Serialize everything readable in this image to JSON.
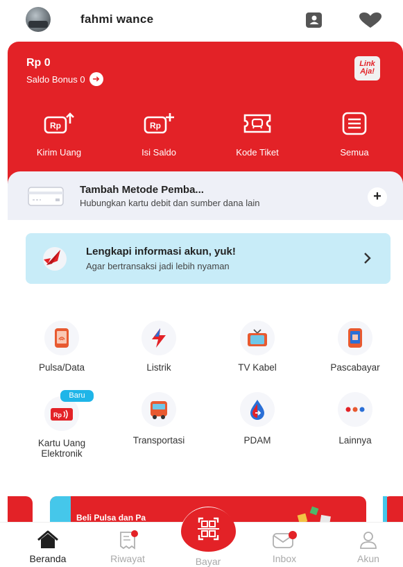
{
  "header": {
    "username": "fahmi wance",
    "icons": [
      "contacts-icon",
      "heart-icon"
    ]
  },
  "balance_card": {
    "balance": "Rp 0",
    "bonus_label": "Saldo Bonus 0",
    "logo_text_1": "Link",
    "logo_text_2": "Aja!",
    "quick_actions": [
      {
        "label": "Kirim Uang",
        "icon": "send-money-icon"
      },
      {
        "label": "Isi Saldo",
        "icon": "top-up-icon"
      },
      {
        "label": "Kode Tiket",
        "icon": "ticket-code-icon"
      },
      {
        "label": "Semua",
        "icon": "all-menu-icon"
      }
    ],
    "color": "#e32227"
  },
  "payment_method": {
    "title": "Tambah Metode Pemba...",
    "subtitle": "Hubungkan kartu debit dan sumber dana lain",
    "action": "+"
  },
  "info_banner": {
    "title": "Lengkapi informasi akun, yuk!",
    "subtitle": "Agar bertransaksi jadi lebih nyaman"
  },
  "services": [
    {
      "label": "Pulsa/Data",
      "icon": "phone-signal-icon"
    },
    {
      "label": "Listrik",
      "icon": "lightning-icon"
    },
    {
      "label": "TV Kabel",
      "icon": "tv-icon"
    },
    {
      "label": "Pascabayar",
      "icon": "postpaid-phone-icon"
    },
    {
      "label": "Kartu Uang Elektronik",
      "icon": "emoney-card-icon",
      "badge": "Baru"
    },
    {
      "label": "Transportasi",
      "icon": "bus-icon"
    },
    {
      "label": "PDAM",
      "icon": "water-drop-icon"
    },
    {
      "label": "Lainnya",
      "icon": "more-dots-icon"
    }
  ],
  "promo": {
    "text": "Beli Pulsa dan Pa"
  },
  "bottom_nav": [
    {
      "label": "Beranda",
      "icon": "home-icon",
      "active": true
    },
    {
      "label": "Riwayat",
      "icon": "receipt-icon",
      "active": false
    },
    {
      "label": "Bayar",
      "icon": "qr-scan-icon",
      "active": false
    },
    {
      "label": "Inbox",
      "icon": "mail-icon",
      "active": false
    },
    {
      "label": "Akun",
      "icon": "user-icon",
      "active": false
    }
  ]
}
